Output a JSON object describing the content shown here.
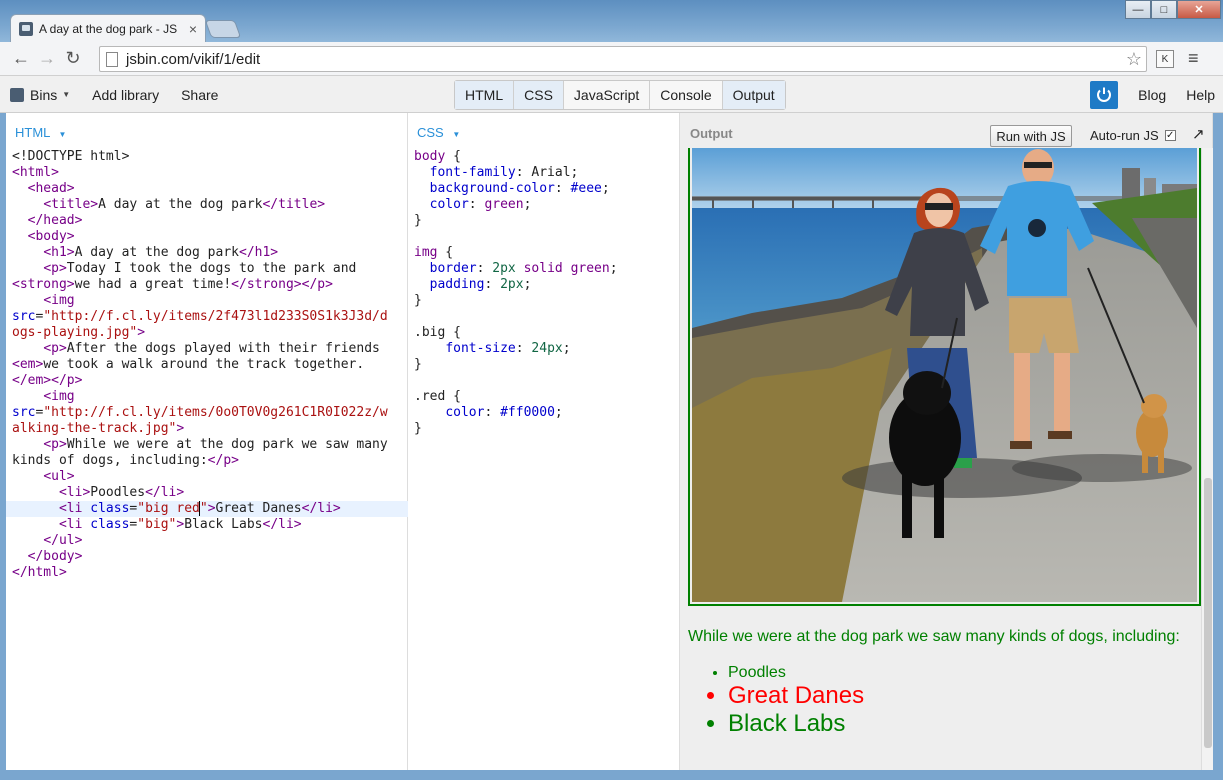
{
  "browser": {
    "tab_title": "A day at the dog park - JS",
    "tab_close": "×",
    "address": "jsbin.com/vikif/1/edit",
    "win_min": "—",
    "win_max": "□",
    "win_close": "✕",
    "back_icon": "←",
    "forward_icon": "→",
    "reload_icon": "↻",
    "star_icon": "☆",
    "ext_label": "K",
    "menu_icon": "≡"
  },
  "jsbin": {
    "bins_label": "Bins",
    "add_library": "Add library",
    "share": "Share",
    "panels": [
      "HTML",
      "CSS",
      "JavaScript",
      "Console",
      "Output"
    ],
    "blog": "Blog",
    "help": "Help"
  },
  "html_panel": {
    "label": "HTML"
  },
  "css_panel": {
    "label": "CSS"
  },
  "output_panel": {
    "label": "Output",
    "run_button": "Run with JS",
    "autorun_label": "Auto-run JS",
    "autorun_checked": "✓",
    "popout_icon": "↗",
    "paragraph": "While we were at the dog park we saw many kinds of dogs, including:",
    "list": [
      {
        "text": "Poodles",
        "classes": ""
      },
      {
        "text": "Great Danes",
        "classes": "big red"
      },
      {
        "text": "Black Labs",
        "classes": "big"
      }
    ]
  },
  "colors": {
    "accent": "#1e7ac6",
    "output_text": "#008000",
    "red": "#ff0000"
  }
}
